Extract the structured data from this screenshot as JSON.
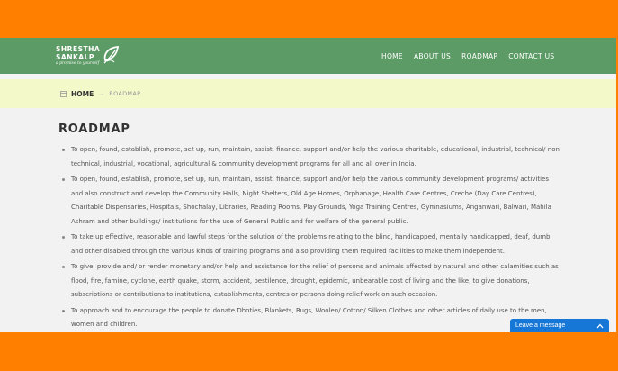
{
  "brand": {
    "line1": "SHRESTHA",
    "line2": "SANKALP",
    "tagline": "a promise to yourself"
  },
  "nav": {
    "items": [
      {
        "label": "HOME"
      },
      {
        "label": "ABOUT US"
      },
      {
        "label": "ROADMAP"
      },
      {
        "label": "CONTACT US"
      }
    ]
  },
  "breadcrumb": {
    "home": "HOME",
    "separator": "→",
    "current": "ROADMAP"
  },
  "page": {
    "title": "ROADMAP",
    "points": [
      "To open, found, establish, promote, set up, run, maintain, assist, finance, support and/or help the various charitable, educational, industrial, technical/ non technical, industrial, vocational, agricultural & community development programs for all and all over in India.",
      "To open, found, establish, promote, set up, run, maintain, assist, finance, support and/or help the various community development programs/ activities and also construct and develop the Community Halls, Night Shelters, Old Age Homes, Orphanage, Health Care Centres, Creche (Day Care Centres), Charitable Dispensaries, Hospitals, Shochalay, Libraries, Reading Rooms, Play Grounds, Yoga Training Centres, Gymnasiums, Anganwari, Balwari, Mahila Ashram and other buildings/ institutions for the use of General Public and for welfare of the general public.",
      "To take up effective, reasonable and lawful steps for the solution of the problems relating to the blind, handicapped, mentally handicapped, deaf, dumb and other disabled through the various kinds of training programs and also providing them required facilities to make them independent.",
      "To give, provide and/ or render monetary and/or help and assistance for the relief of persons and animals affected by natural and other calamities such as flood, fire, famine, cyclone, earth quake, storm, accident, pestilence, drought, epidemic, unbearable cost of living and the like, to give donations, subscriptions or contributions to institutions, establishments, centres or persons doing relief work on such occasion.",
      "To approach and to encourage the people to donate Dhoties, Blankets, Rugs, Woolen/ Cotton/ Silken Clothes and other articles of daily use to the men, women and children."
    ]
  },
  "chat": {
    "label": "Leave a message"
  },
  "colors": {
    "frame": "#ff7f00",
    "navbar": "#5d9b66",
    "breadcrumb_bg": "#f3f9c9",
    "chat": "#1677d6"
  }
}
